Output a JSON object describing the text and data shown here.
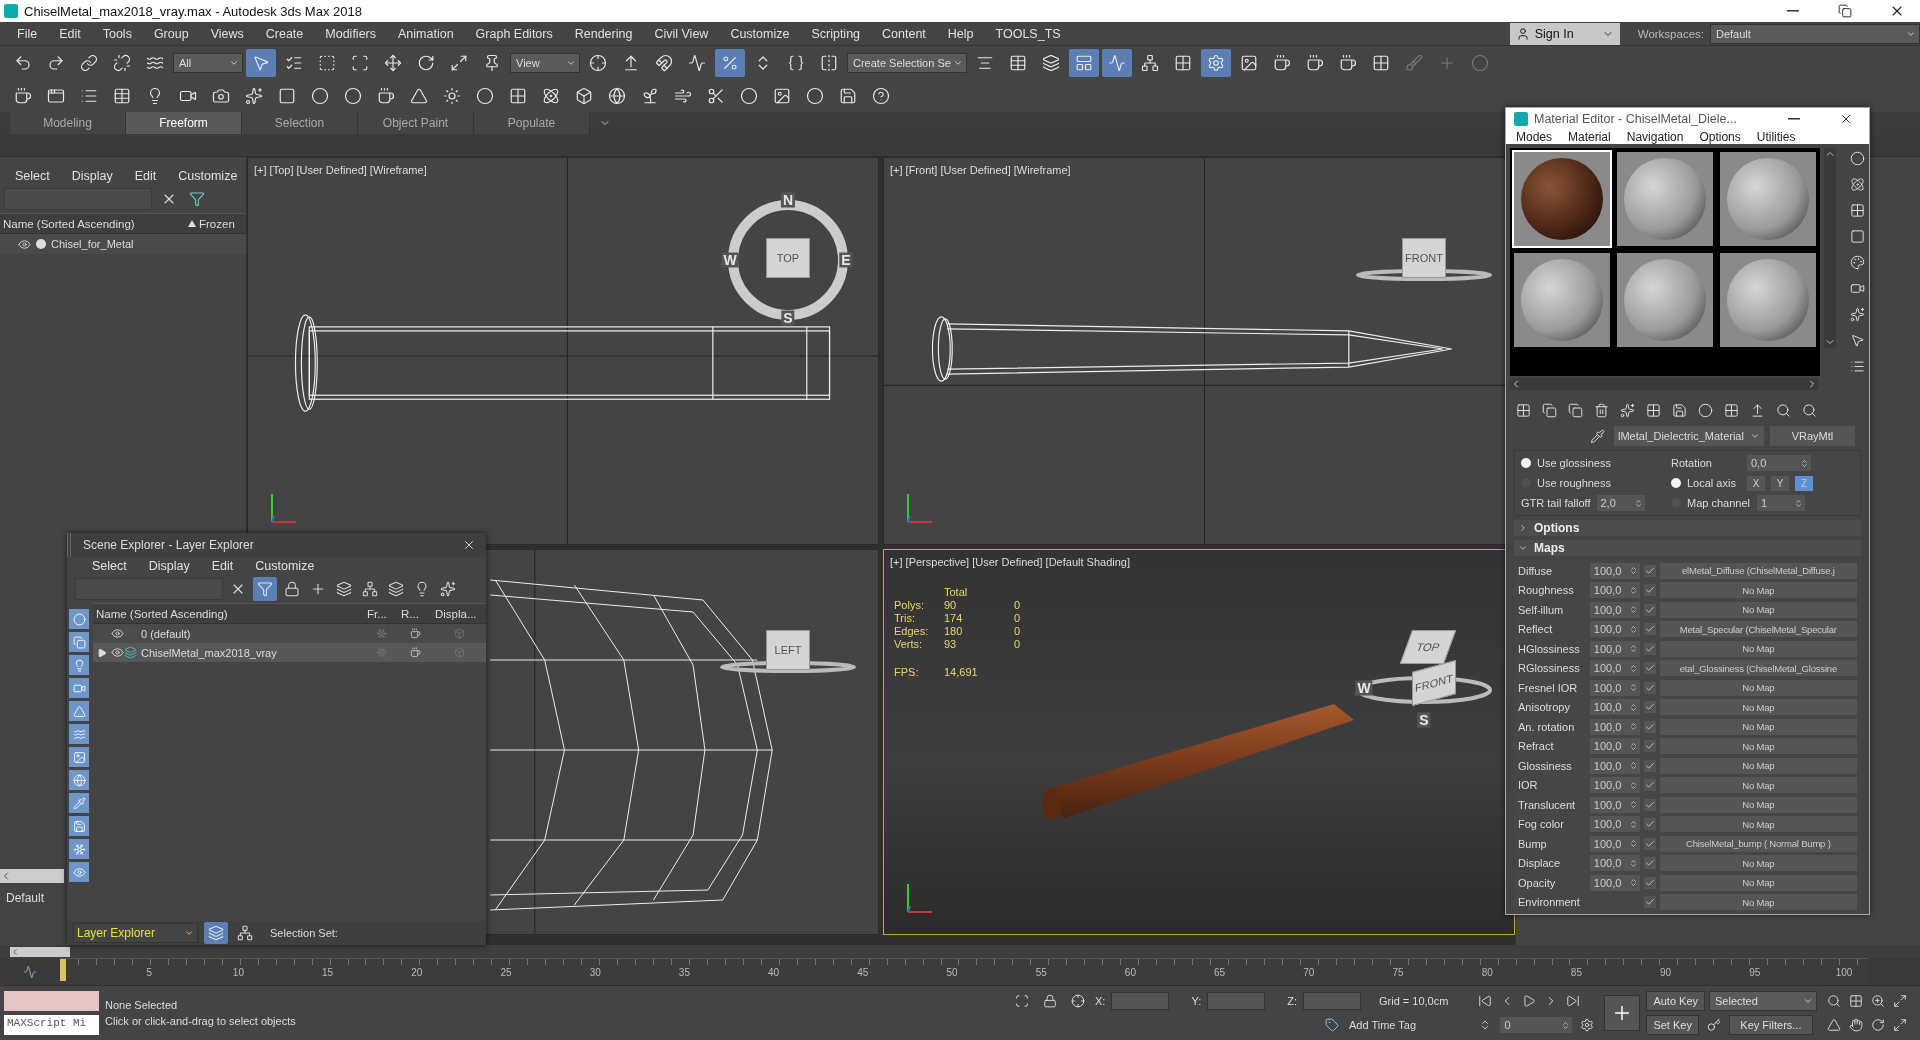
{
  "window": {
    "title": "ChiselMetal_max2018_vray.max - Autodesk 3ds Max 2018"
  },
  "menu": [
    "File",
    "Edit",
    "Tools",
    "Group",
    "Views",
    "Create",
    "Modifiers",
    "Animation",
    "Graph Editors",
    "Rendering",
    "Civil View",
    "Customize",
    "Scripting",
    "Content",
    "Help",
    "TOOLS_TS"
  ],
  "account": {
    "label": "Sign In"
  },
  "workspaces": {
    "label": "Workspaces:",
    "value": "Default"
  },
  "main_toolbar": [
    {
      "kind": "button",
      "selected": false
    },
    {
      "kind": "button",
      "selected": false
    },
    {
      "kind": "button",
      "selected": false
    },
    {
      "kind": "button",
      "selected": false
    },
    {
      "kind": "button",
      "selected": false
    },
    {
      "kind": "dropdown",
      "value": "All"
    },
    {
      "kind": "button",
      "selected": true
    },
    {
      "kind": "button",
      "selected": false
    },
    {
      "kind": "button",
      "selected": false
    },
    {
      "kind": "button",
      "selected": false
    },
    {
      "kind": "button",
      "selected": false
    },
    {
      "kind": "button",
      "selected": false
    },
    {
      "kind": "button",
      "selected": false
    },
    {
      "kind": "button",
      "selected": false
    },
    {
      "kind": "dropdown",
      "value": "View"
    },
    {
      "kind": "button",
      "selected": false
    },
    {
      "kind": "button",
      "selected": false
    },
    {
      "kind": "button",
      "selected": false
    },
    {
      "kind": "button",
      "selected": false
    },
    {
      "kind": "button",
      "selected": true
    },
    {
      "kind": "button",
      "selected": false
    },
    {
      "kind": "button",
      "selected": false
    },
    {
      "kind": "button",
      "selected": false
    },
    {
      "kind": "dropdown",
      "value": "Create Selection Se"
    },
    {
      "kind": "button",
      "selected": false
    },
    {
      "kind": "button",
      "selected": false
    },
    {
      "kind": "button",
      "selected": false
    },
    {
      "kind": "button",
      "selected": true
    },
    {
      "kind": "button",
      "selected": true
    },
    {
      "kind": "button",
      "selected": false
    },
    {
      "kind": "button",
      "selected": false
    },
    {
      "kind": "button",
      "selected": true
    },
    {
      "kind": "button",
      "selected": false
    },
    {
      "kind": "button",
      "selected": false
    },
    {
      "kind": "button",
      "selected": false
    },
    {
      "kind": "button",
      "selected": false
    },
    {
      "kind": "button",
      "selected": false
    },
    {
      "kind": "button",
      "selected": false
    },
    {
      "kind": "button",
      "selected": false
    },
    {
      "kind": "button",
      "selected": false
    }
  ],
  "ribbon_tabs": [
    {
      "label": "Modeling",
      "selected": false
    },
    {
      "label": "Freeform",
      "selected": true
    },
    {
      "label": "Selection",
      "selected": false
    },
    {
      "label": "Object Paint",
      "selected": false
    },
    {
      "label": "Populate",
      "selected": false
    }
  ],
  "scene_explorer": {
    "menu": [
      "Select",
      "Display",
      "Edit",
      "Customize"
    ],
    "columns": [
      "Name (Sorted Ascending)",
      "Frozen"
    ],
    "rows": [
      {
        "name": "Chisel_for_Metal"
      }
    ],
    "footer": "Default"
  },
  "viewports": [
    {
      "kind": "top",
      "label": "[+] [Top] [User Defined] [Wireframe]",
      "active": false,
      "cube": {
        "faces": [
          "TOP"
        ],
        "compass": [
          "N",
          "W",
          "E",
          "S"
        ]
      }
    },
    {
      "kind": "front",
      "label": "[+] [Front] [User Defined] [Wireframe]",
      "active": false,
      "cube": {
        "faces": [
          "FRONT"
        ]
      }
    },
    {
      "kind": "left",
      "active": false,
      "cube": {
        "faces": [
          "LEFT"
        ]
      }
    },
    {
      "kind": "perspective",
      "label": "[+] [Perspective] [User Defined] [Default Shading]",
      "active": true,
      "cube": {
        "faces": [
          "TOP",
          "FRONT"
        ],
        "compass": [
          "W",
          "S"
        ]
      }
    }
  ],
  "stats": {
    "header": "Total",
    "rows": [
      {
        "label": "Polys:",
        "total": "90",
        "selection": "0"
      },
      {
        "label": "Tris:",
        "total": "174",
        "selection": "0"
      },
      {
        "label": "Edges:",
        "total": "180",
        "selection": "0"
      },
      {
        "label": "Verts:",
        "total": "93",
        "selection": "0"
      }
    ],
    "fps_label": "FPS:",
    "fps": "14,691"
  },
  "layer_explorer": {
    "title": "Scene Explorer - Layer Explorer",
    "menu": [
      "Select",
      "Display",
      "Edit",
      "Customize"
    ],
    "columns": [
      "Name (Sorted Ascending)",
      "Fr...",
      "R...",
      "Displa..."
    ],
    "rows": [
      {
        "name": "0 (default)",
        "kind": "layer",
        "selected": false
      },
      {
        "name": "ChiselMetal_max2018_vray",
        "kind": "group",
        "expanded": false,
        "selected": true
      }
    ],
    "mode": "Layer Explorer",
    "selection_label": "Selection Set:"
  },
  "material_editor": {
    "title": "Material Editor - ChiselMetal_Diele...",
    "menu": [
      "Modes",
      "Material",
      "Navigation",
      "Options",
      "Utilities"
    ],
    "slots": [
      {
        "kind": "textured",
        "selected": true
      },
      {
        "kind": "plain",
        "selected": false
      },
      {
        "kind": "plain",
        "selected": false
      },
      {
        "kind": "plain",
        "selected": false
      },
      {
        "kind": "plain",
        "selected": false
      },
      {
        "kind": "plain",
        "selected": false
      }
    ],
    "material_name": "lMetal_Dielectric_Material",
    "material_type": "VRayMtl",
    "brdf": [
      {
        "label": "Use glossiness",
        "selected": true
      },
      {
        "label": "Use roughness",
        "selected": false
      }
    ],
    "gtr": {
      "label": "GTR tail falloff",
      "value": "2,0"
    },
    "rotation": {
      "label": "Rotation",
      "value": "0,0"
    },
    "mapping": [
      {
        "label": "Local axis",
        "selected": true
      },
      {
        "label": "Map channel",
        "selected": false
      }
    ],
    "axes": [
      {
        "label": "X",
        "selected": false
      },
      {
        "label": "Y",
        "selected": false
      },
      {
        "label": "Z",
        "selected": true
      }
    ],
    "map_channel": "1",
    "rollouts": [
      {
        "label": "Options",
        "expanded": false
      },
      {
        "label": "Maps",
        "expanded": true
      }
    ],
    "maps": [
      {
        "label": "Diffuse",
        "amount": "100,0",
        "checked": true,
        "map": "elMetal_Diffuse (ChiselMetal_Diffuse.j"
      },
      {
        "label": "Roughness",
        "amount": "100,0",
        "checked": true,
        "map": "No Map"
      },
      {
        "label": "Self-illum",
        "amount": "100,0",
        "checked": true,
        "map": "No Map"
      },
      {
        "label": "Reflect",
        "amount": "100,0",
        "checked": true,
        "map": "Metal_Specular (ChiselMetal_Specular"
      },
      {
        "label": "HGlossiness",
        "amount": "100,0",
        "checked": true,
        "map": "No Map"
      },
      {
        "label": "RGlossiness",
        "amount": "100,0",
        "checked": true,
        "map": "etal_Glossiness (ChiselMetal_Glossine"
      },
      {
        "label": "Fresnel IOR",
        "amount": "100,0",
        "checked": true,
        "map": "No Map"
      },
      {
        "label": "Anisotropy",
        "amount": "100,0",
        "checked": true,
        "map": "No Map"
      },
      {
        "label": "An. rotation",
        "amount": "100,0",
        "checked": true,
        "map": "No Map"
      },
      {
        "label": "Refract",
        "amount": "100,0",
        "checked": true,
        "map": "No Map"
      },
      {
        "label": "Glossiness",
        "amount": "100,0",
        "checked": true,
        "map": "No Map"
      },
      {
        "label": "IOR",
        "amount": "100,0",
        "checked": true,
        "map": "No Map"
      },
      {
        "label": "Translucent",
        "amount": "100,0",
        "checked": true,
        "map": "No Map"
      },
      {
        "label": "Fog color",
        "amount": "100,0",
        "checked": true,
        "map": "No Map"
      },
      {
        "label": "Bump",
        "amount": "100,0",
        "checked": true,
        "map": "ChiselMetal_bump ( Normal Bump )"
      },
      {
        "label": "Displace",
        "amount": "100,0",
        "checked": true,
        "map": "No Map"
      },
      {
        "label": "Opacity",
        "amount": "100,0",
        "checked": true,
        "map": "No Map"
      },
      {
        "label": "Environment",
        "checked": true,
        "map": "No Map"
      }
    ]
  },
  "timeline": {
    "ticks": [
      "5",
      "10",
      "15",
      "20",
      "25",
      "30",
      "35",
      "40",
      "45",
      "50",
      "55",
      "60",
      "65",
      "70",
      "75",
      "80",
      "85",
      "90",
      "95",
      "100"
    ]
  },
  "status": {
    "maxscript": "MAXScript Mi",
    "selection": "None Selected",
    "prompt": "Click or click-and-drag to select objects",
    "coords": [
      "X:",
      "Y:",
      "Z:"
    ],
    "grid": "Grid = 10,0cm",
    "time_tag": "Add Time Tag",
    "frame": "0",
    "auto_key": "Auto Key",
    "key_mode": "Selected",
    "set_key": "Set Key",
    "key_filters": "Key Filters..."
  }
}
